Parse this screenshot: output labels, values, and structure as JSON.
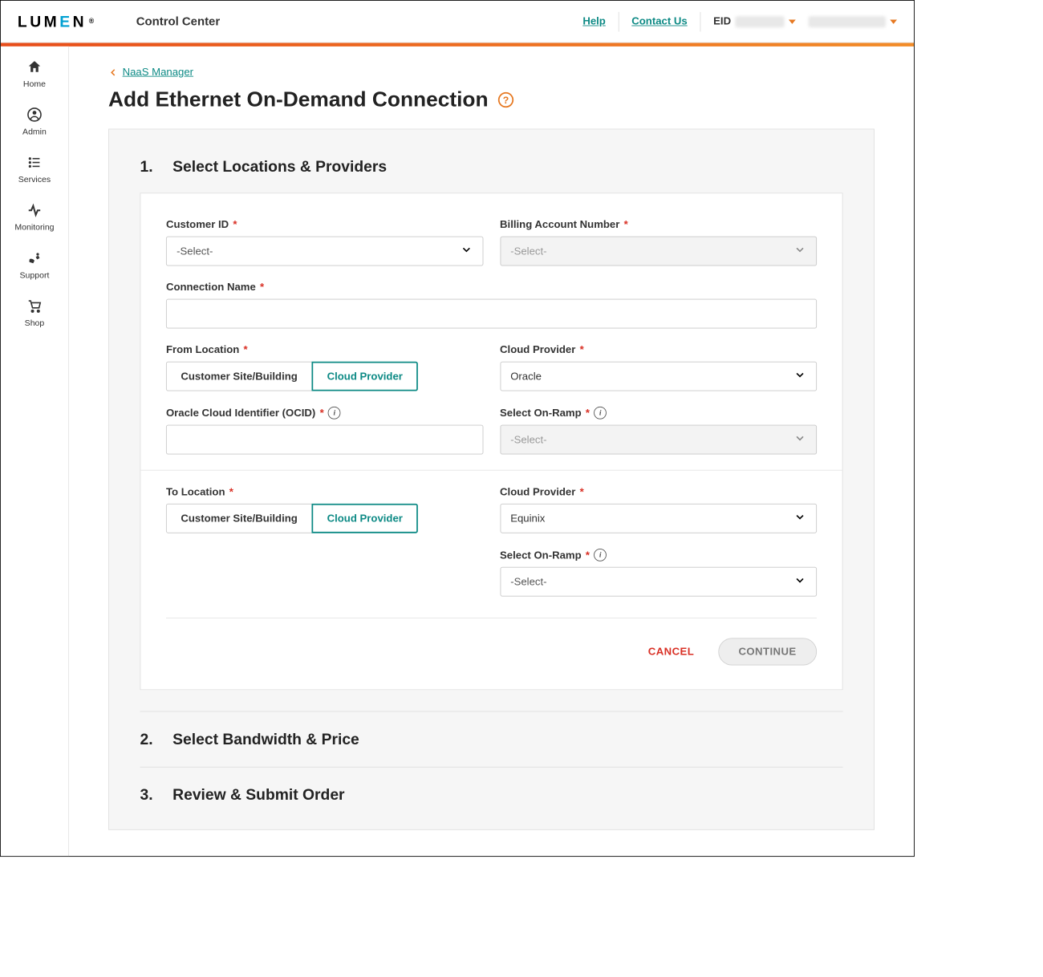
{
  "brand": {
    "text": "LUMEN"
  },
  "header": {
    "app_name": "Control Center",
    "help": "Help",
    "contact": "Contact Us",
    "eid_label": "EID"
  },
  "sidebar": {
    "items": [
      {
        "label": "Home"
      },
      {
        "label": "Admin"
      },
      {
        "label": "Services"
      },
      {
        "label": "Monitoring"
      },
      {
        "label": "Support"
      },
      {
        "label": "Shop"
      }
    ]
  },
  "breadcrumb": {
    "label": "NaaS Manager"
  },
  "page": {
    "title": "Add Ethernet On-Demand Connection"
  },
  "steps": {
    "s1": {
      "num": "1.",
      "title": "Select Locations & Providers"
    },
    "s2": {
      "num": "2.",
      "title": "Select Bandwidth & Price"
    },
    "s3": {
      "num": "3.",
      "title": "Review & Submit Order"
    }
  },
  "form": {
    "customer_id": {
      "label": "Customer ID",
      "value": "-Select-"
    },
    "ban": {
      "label": "Billing Account Number",
      "value": "-Select-"
    },
    "conn_name": {
      "label": "Connection Name"
    },
    "from_loc": {
      "label": "From Location",
      "opt1": "Customer Site/Building",
      "opt2": "Cloud Provider"
    },
    "from_cloud": {
      "label": "Cloud Provider",
      "value": "Oracle"
    },
    "ocid": {
      "label": "Oracle Cloud Identifier (OCID)"
    },
    "from_onramp": {
      "label": "Select On-Ramp",
      "value": "-Select-"
    },
    "to_loc": {
      "label": "To Location",
      "opt1": "Customer Site/Building",
      "opt2": "Cloud Provider"
    },
    "to_cloud": {
      "label": "Cloud Provider",
      "value": "Equinix"
    },
    "to_onramp": {
      "label": "Select On-Ramp",
      "value": "-Select-"
    }
  },
  "actions": {
    "cancel": "CANCEL",
    "continue": "CONTINUE"
  }
}
